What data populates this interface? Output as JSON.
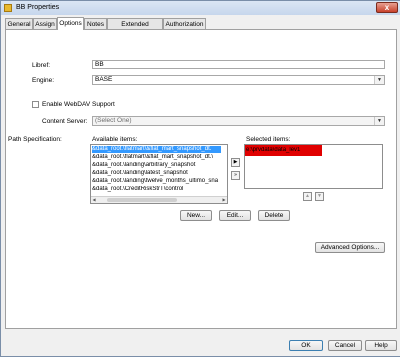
{
  "window": {
    "title": "BB Properties",
    "close_glyph": "x"
  },
  "tabs": [
    {
      "label": "General"
    },
    {
      "label": "Assign"
    },
    {
      "label": "Options"
    },
    {
      "label": "Notes"
    },
    {
      "label": "Extended Attributes"
    },
    {
      "label": "Authorization"
    }
  ],
  "active_tab": "Options",
  "form": {
    "libref_label": "Libref:",
    "libref_value": "BB",
    "engine_label": "Engine:",
    "engine_value": "BASE",
    "webdav_label": "Enable WebDAV Support",
    "webdav_checked": false,
    "content_server_label": "Content Server:",
    "content_server_value": "(Select One)"
  },
  "path_spec": {
    "label": "Path Specification:",
    "available_label": "Available items:",
    "available_items": [
      "&data_root.\\flatmart\\&flat_mart_snapshot_dt.",
      "&data_root.\\flatmart\\&flat_mart_snapshot_dt.\\",
      "&data_root.\\landing\\arbitrary_snapshot",
      "&data_root.\\landing\\latest_snapshot",
      "&data_root.\\landing\\twelve_months_ultimo_sna",
      "&data_root.\\CreditRiskStrT\\control"
    ],
    "selected_index": 0,
    "move_right_glyph": "▶",
    "move_all_right_glyph": "»",
    "selected_label": "Selected items:",
    "selected_items": [
      "e:\\prvdata\\data_lev1"
    ],
    "up_glyph": "▲",
    "down_glyph": "▼",
    "scroll_left_glyph": "◀",
    "scroll_right_glyph": "▶"
  },
  "buttons": {
    "new": "New...",
    "edit": "Edit...",
    "delete": "Delete",
    "advanced": "Advanced Options...",
    "ok": "OK",
    "cancel": "Cancel",
    "help": "Help"
  },
  "colors": {
    "selection": "#3399ff",
    "highlight_annotation": "#e00000"
  }
}
